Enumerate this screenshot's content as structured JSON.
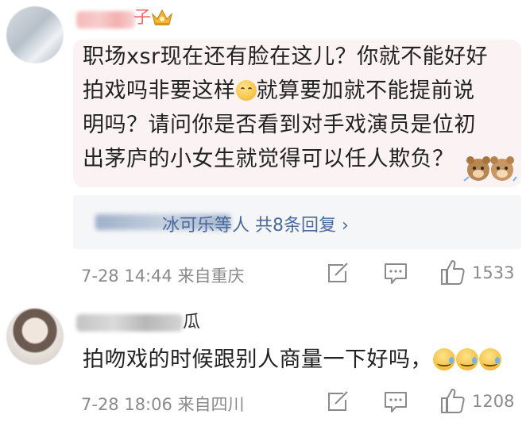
{
  "comment1": {
    "name_suffix": "子",
    "text_line1": "职场xsr现在还有脸在这儿？你就不能好好",
    "text_line2a": "拍戏吗非要这样",
    "text_line2b": "就算要加就不能提前说",
    "text_line3": "明吗？请问你是否看到对手戏演员是位初",
    "text_line4": "出茅庐的小女生就觉得可以任人欺负？",
    "reply_summary": "冰可乐等人  共8条回复 ›",
    "meta": "7-28 14:44  来自重庆",
    "likes": "1533"
  },
  "comment2": {
    "name_suffix": "瓜",
    "text": "拍吻戏的时候跟别人商量一下好吗，",
    "meta": "7-28 18:06  来自四川",
    "likes": "1208"
  },
  "colors": {
    "name_pink": "#f06767",
    "link_blue": "#4a6a9c",
    "meta_gray": "#8a8a8a",
    "bubble_bg": "#fbf3f3"
  }
}
